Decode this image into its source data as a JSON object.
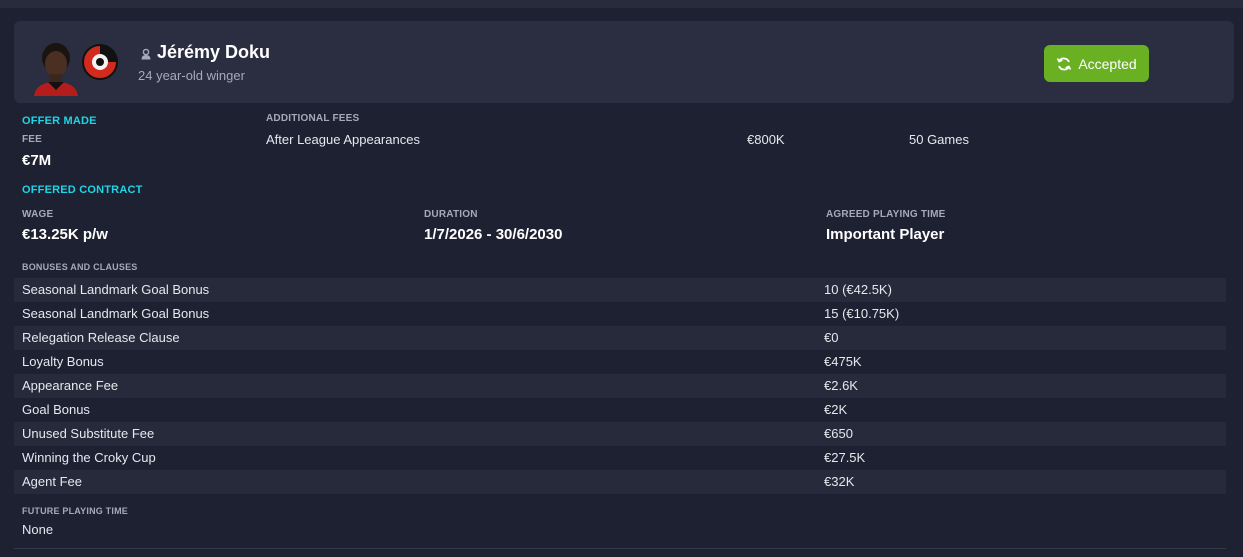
{
  "player": {
    "name": "Jérémy Doku",
    "subtitle": "24 year-old winger",
    "status": "Accepted"
  },
  "offer": {
    "section_title": "OFFER MADE",
    "fee_label": "FEE",
    "fee_value": "€7M",
    "additional_fees_label": "ADDITIONAL FEES",
    "additional_fees": [
      {
        "name": "After League Appearances",
        "amount": "€800K",
        "condition": "50 Games"
      }
    ]
  },
  "contract": {
    "section_title": "OFFERED CONTRACT",
    "wage_label": "WAGE",
    "wage_value": "€13.25K p/w",
    "duration_label": "DURATION",
    "duration_value": "1/7/2026 - 30/6/2030",
    "playing_time_label": "AGREED PLAYING TIME",
    "playing_time_value": "Important Player"
  },
  "bonuses": {
    "label": "BONUSES AND CLAUSES",
    "rows": [
      {
        "name": "Seasonal Landmark Goal Bonus",
        "value": "10 (€42.5K)"
      },
      {
        "name": "Seasonal Landmark Goal Bonus",
        "value": "15 (€10.75K)"
      },
      {
        "name": "Relegation Release Clause",
        "value": "€0"
      },
      {
        "name": "Loyalty Bonus",
        "value": "€475K"
      },
      {
        "name": "Appearance Fee",
        "value": "€2.6K"
      },
      {
        "name": "Goal Bonus",
        "value": "€2K"
      },
      {
        "name": "Unused Substitute Fee",
        "value": "€650"
      },
      {
        "name": "Winning the Croky Cup",
        "value": "€27.5K"
      },
      {
        "name": "Agent Fee",
        "value": "€32K"
      }
    ]
  },
  "future": {
    "label": "FUTURE PLAYING TIME",
    "value": "None"
  },
  "icons": {
    "status": "refresh-icon",
    "person": "person-icon",
    "badge": "club-badge-icon",
    "avatar": "player-avatar"
  },
  "colors": {
    "background": "#1e2131",
    "card": "#2a2e40",
    "accent_cyan": "#1ed5e6",
    "status_green": "#6ab023",
    "badge_red": "#d32a1e"
  }
}
